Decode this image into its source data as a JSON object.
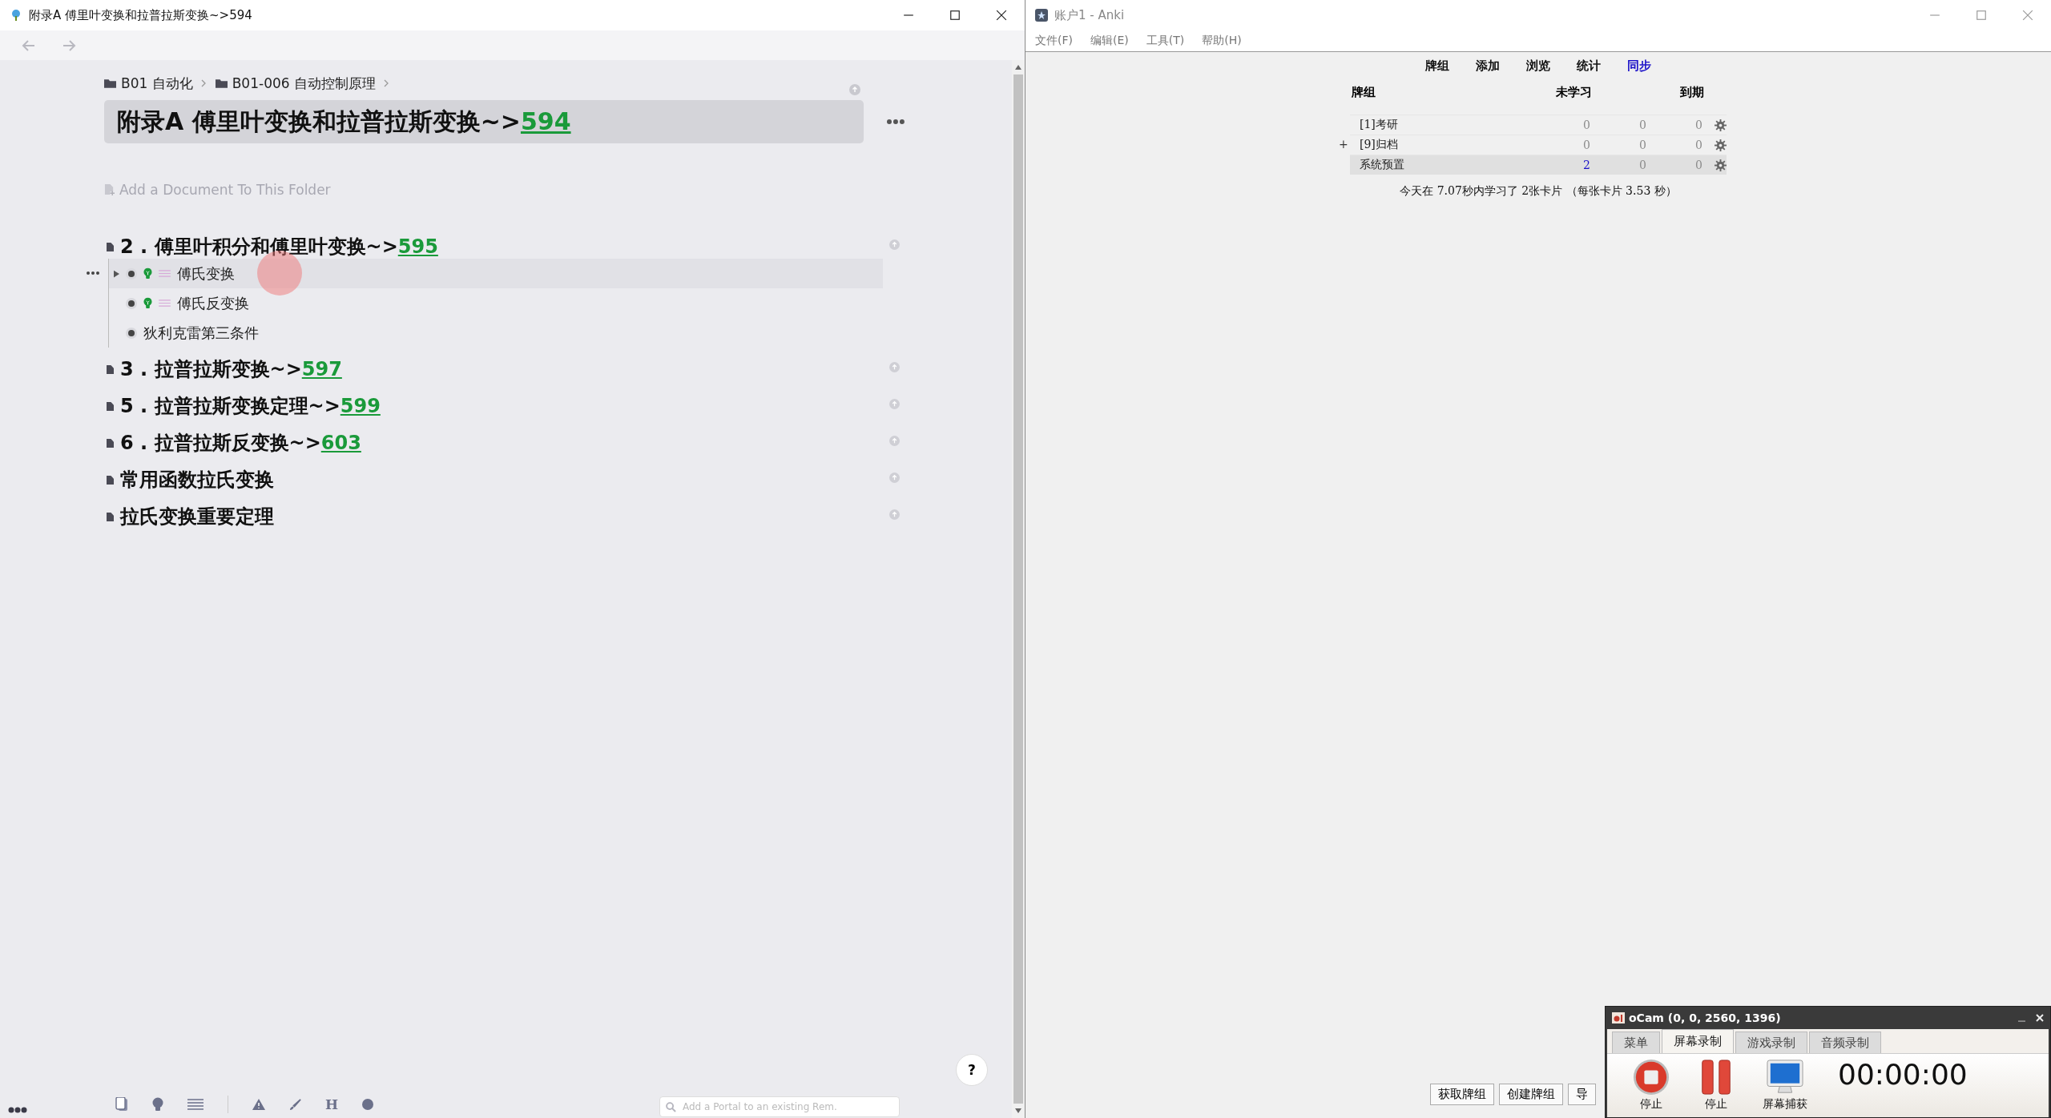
{
  "left_window": {
    "title": "附录A 傅里叶变换和拉普拉斯变换~>594",
    "breadcrumbs": [
      "B01 自动化",
      "B01-006 自动控制原理"
    ],
    "document": {
      "title": "附录A 傅里叶变换和拉普拉斯变换~>",
      "link": "594"
    },
    "add_document": "Add a Document To This Folder",
    "outline": [
      {
        "text": "2 . 傅里叶积分和傅里叶变换~>",
        "link": "595",
        "children": [
          {
            "text": "傅氏变换",
            "flashcard": true,
            "highlighted": true
          },
          {
            "text": "傅氏反变换",
            "flashcard": true,
            "highlighted": false
          },
          {
            "text": "狄利克雷第三条件",
            "flashcard": false,
            "highlighted": false
          }
        ]
      },
      {
        "text": "3 . 拉普拉斯变换~>",
        "link": "597"
      },
      {
        "text": "5 . 拉普拉斯变换定理~>",
        "link": "599"
      },
      {
        "text": "6 . 拉普拉斯反变换~>",
        "link": "603"
      },
      {
        "text": "常用函数拉氏变换"
      },
      {
        "text": "拉氏变换重要定理"
      }
    ],
    "help": "?",
    "toolbar_letter": "H",
    "portal_search": {
      "placeholder": "Add a Portal to an existing Rem."
    }
  },
  "anki": {
    "title": "账户1 - Anki",
    "menu": [
      "文件(F)",
      "编辑(E)",
      "工具(T)",
      "帮助(H)"
    ],
    "toolbar": [
      {
        "label": "牌组",
        "highlighted": false
      },
      {
        "label": "添加",
        "highlighted": false
      },
      {
        "label": "浏览",
        "highlighted": false
      },
      {
        "label": "统计",
        "highlighted": false
      },
      {
        "label": "同步",
        "highlighted": true
      }
    ],
    "columns": [
      "牌组",
      "未学习",
      "到期"
    ],
    "decks": [
      {
        "name": "[1]考研",
        "selected": false,
        "counts": [
          {
            "text": "0",
            "active": false
          },
          {
            "text": "0",
            "active": false
          },
          {
            "text": "0",
            "active": false
          }
        ]
      },
      {
        "expander": "+",
        "name": "[9]归档",
        "selected": false,
        "counts": [
          {
            "text": "0",
            "active": false
          },
          {
            "text": "0",
            "active": false
          },
          {
            "text": "0",
            "active": false
          }
        ]
      },
      {
        "name": "系统预置",
        "selected": true,
        "counts": [
          {
            "text": "2",
            "active": true
          },
          {
            "text": "0",
            "active": false
          },
          {
            "text": "0",
            "active": false
          }
        ]
      }
    ],
    "summary": "今天在 7.07秒内学习了 2张卡片 （每张卡片 3.53 秒）",
    "buttons": [
      "获取牌组",
      "创建牌组",
      "导"
    ]
  },
  "ocam": {
    "title": "oCam (0, 0, 2560, 1396)",
    "tabs": [
      {
        "label": "菜单",
        "selected": false
      },
      {
        "label": "屏幕录制",
        "selected": true
      },
      {
        "label": "游戏录制",
        "selected": false
      },
      {
        "label": "音频录制",
        "selected": false
      }
    ],
    "actions": [
      {
        "label": "停止",
        "kind": "stop"
      },
      {
        "label": "停止",
        "kind": "pause"
      },
      {
        "label": "屏幕捕获",
        "kind": "capture"
      }
    ],
    "timer": "00:00:00"
  }
}
